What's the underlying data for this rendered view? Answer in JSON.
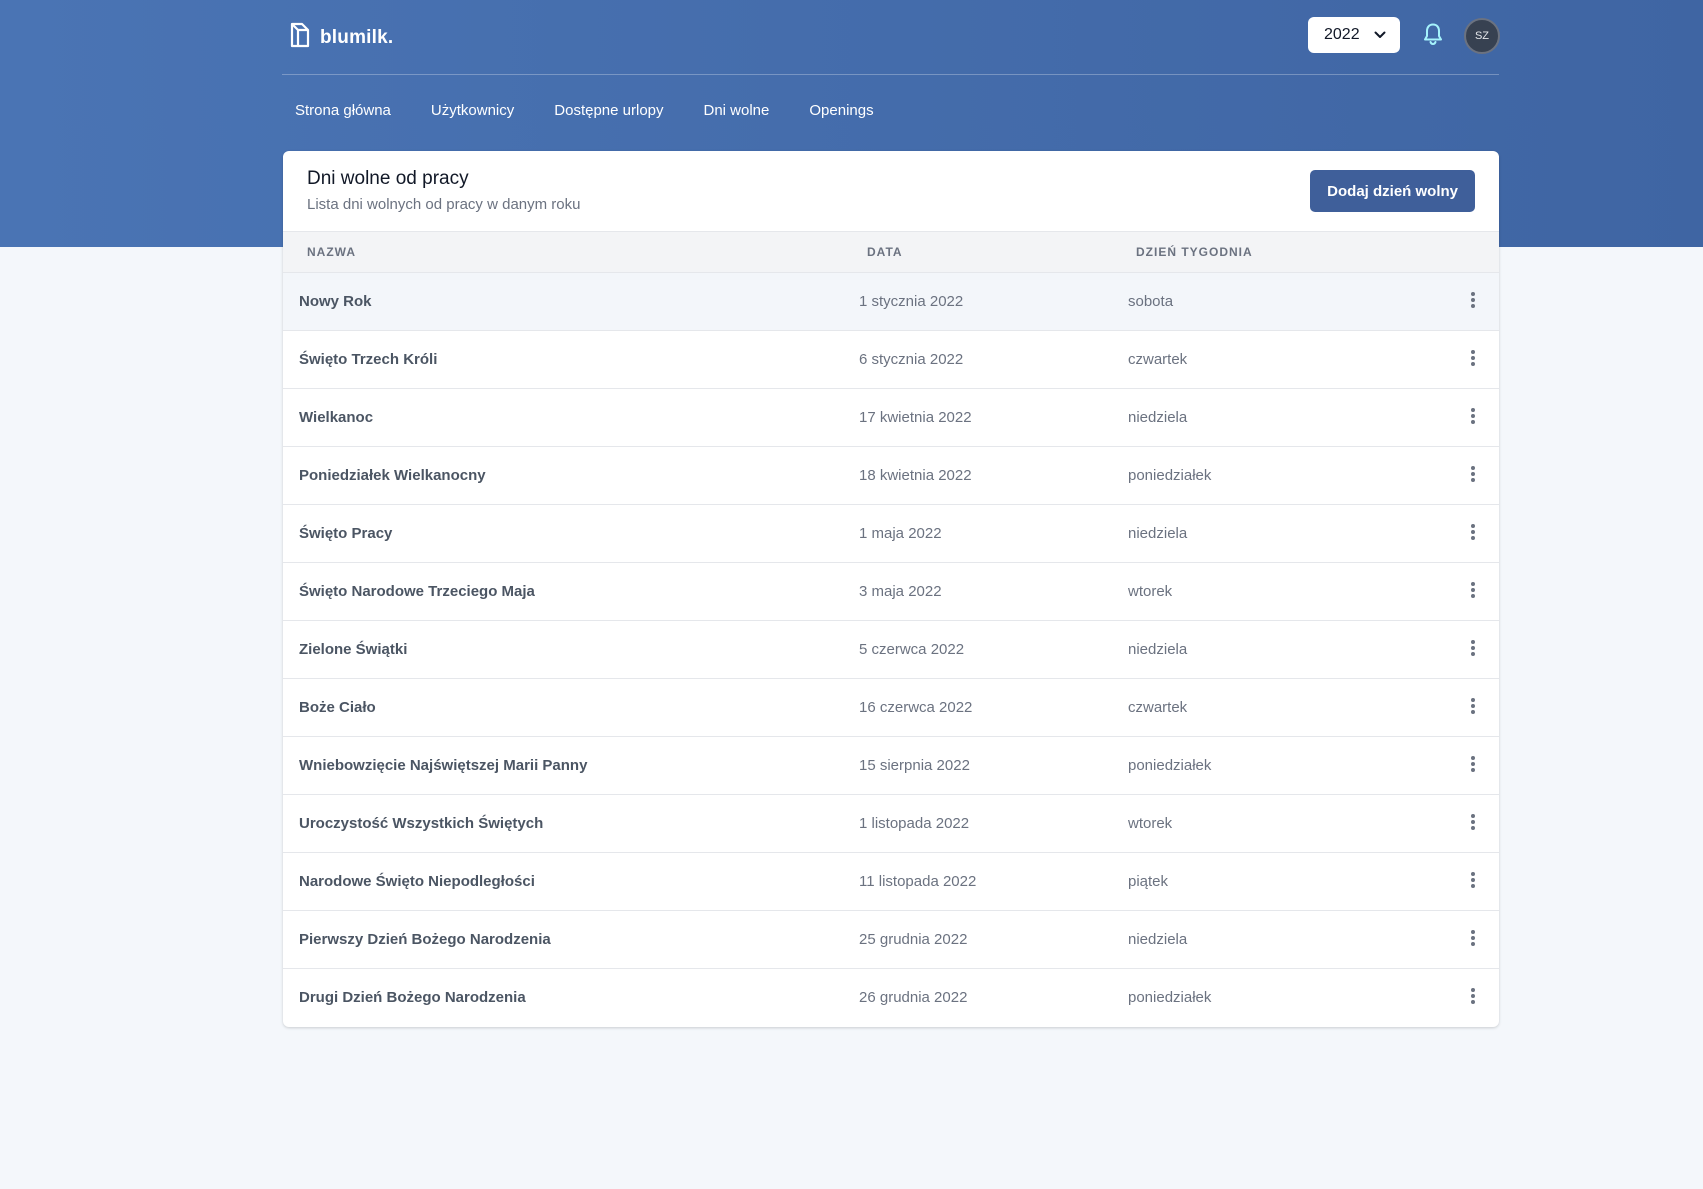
{
  "brand": {
    "name": "blumilk.",
    "logo_icon": "milk-carton-icon"
  },
  "header": {
    "year_select": {
      "value": "2022",
      "icon": "chevron-down-icon"
    },
    "notifications_icon": "bell-icon",
    "avatar_initials": "SZ"
  },
  "nav": {
    "items": [
      {
        "label": "Strona główna"
      },
      {
        "label": "Użytkownicy"
      },
      {
        "label": "Dostępne urlopy"
      },
      {
        "label": "Dni wolne"
      },
      {
        "label": "Openings"
      }
    ]
  },
  "page": {
    "title": "Dni wolne od pracy",
    "subtitle": "Lista dni wolnych od pracy w danym roku",
    "add_button_label": "Dodaj dzień wolny"
  },
  "table": {
    "columns": {
      "name": "NAZWA",
      "date": "DATA",
      "weekday": "DZIEŃ TYGODNIA"
    },
    "row_menu_icon": "dots-vertical-icon",
    "rows": [
      {
        "name": "Nowy Rok",
        "date": "1 stycznia 2022",
        "weekday": "sobota"
      },
      {
        "name": "Święto Trzech Króli",
        "date": "6 stycznia 2022",
        "weekday": "czwartek"
      },
      {
        "name": "Wielkanoc",
        "date": "17 kwietnia 2022",
        "weekday": "niedziela"
      },
      {
        "name": "Poniedziałek Wielkanocny",
        "date": "18 kwietnia 2022",
        "weekday": "poniedziałek"
      },
      {
        "name": "Święto Pracy",
        "date": "1 maja 2022",
        "weekday": "niedziela"
      },
      {
        "name": "Święto Narodowe Trzeciego Maja",
        "date": "3 maja 2022",
        "weekday": "wtorek"
      },
      {
        "name": "Zielone Świątki",
        "date": "5 czerwca 2022",
        "weekday": "niedziela"
      },
      {
        "name": "Boże Ciało",
        "date": "16 czerwca 2022",
        "weekday": "czwartek"
      },
      {
        "name": "Wniebowzięcie Najświętszej Marii Panny",
        "date": "15 sierpnia 2022",
        "weekday": "poniedziałek"
      },
      {
        "name": "Uroczystość Wszystkich Świętych",
        "date": "1 listopada 2022",
        "weekday": "wtorek"
      },
      {
        "name": "Narodowe Święto Niepodległości",
        "date": "11 listopada 2022",
        "weekday": "piątek"
      },
      {
        "name": "Pierwszy Dzień Bożego Narodzenia",
        "date": "25 grudnia 2022",
        "weekday": "niedziela"
      },
      {
        "name": "Drugi Dzień Bożego Narodzenia",
        "date": "26 grudnia 2022",
        "weekday": "poniedziałek"
      }
    ]
  },
  "colors": {
    "header_bg": "#4a74b4",
    "primary_button": "#3f5f9a",
    "page_bg": "#f4f7fb"
  }
}
